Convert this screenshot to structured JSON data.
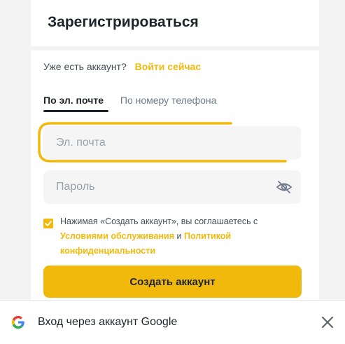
{
  "header": {
    "title": "Зарегистрироваться"
  },
  "login_prompt": {
    "question": "Уже есть аккаунт?",
    "link": "Войти сейчас"
  },
  "tabs": [
    {
      "label": "По эл. почте",
      "active": true
    },
    {
      "label": "По номеру телефона",
      "active": false
    }
  ],
  "form": {
    "email_placeholder": "Эл. почта",
    "email_value": "",
    "password_placeholder": "Пароль",
    "password_value": "",
    "password_visibility_icon": "eye-off-icon"
  },
  "terms": {
    "checked": true,
    "text_before": "Нажимая «Создать аккаунт», вы соглашаетесь с",
    "link_terms": "Условиями обслуживания",
    "conjunction": "и",
    "link_policy": "Политикой конфиденциальности"
  },
  "create_button": {
    "label": "Создать аккаунт"
  },
  "google_prompt": {
    "icon": "google-logo-icon",
    "text": "Вход через аккаунт Google",
    "close_icon": "close-icon"
  },
  "colors": {
    "accent": "#f0b90b",
    "text": "#1e2329",
    "field_bg": "#f5f5f5"
  }
}
